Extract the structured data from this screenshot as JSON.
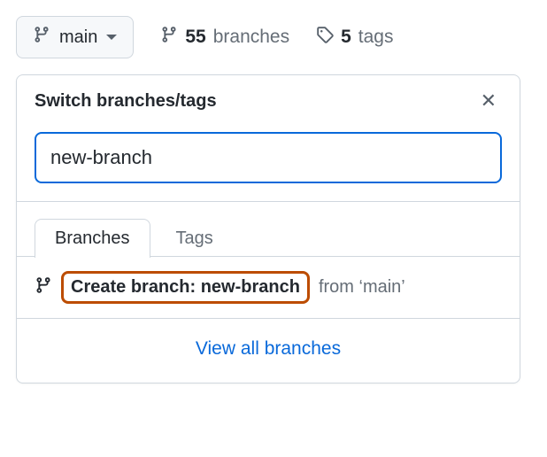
{
  "toprow": {
    "branch_button_label": "main",
    "branches_count": "55",
    "branches_word": "branches",
    "tags_count": "5",
    "tags_word": "tags"
  },
  "panel": {
    "title": "Switch branches/tags",
    "search_value": "new-branch",
    "tabs": {
      "branches": "Branches",
      "tags": "Tags"
    },
    "create": {
      "label": "Create branch: new-branch",
      "from": "from ‘main’"
    },
    "viewall": "View all branches"
  }
}
